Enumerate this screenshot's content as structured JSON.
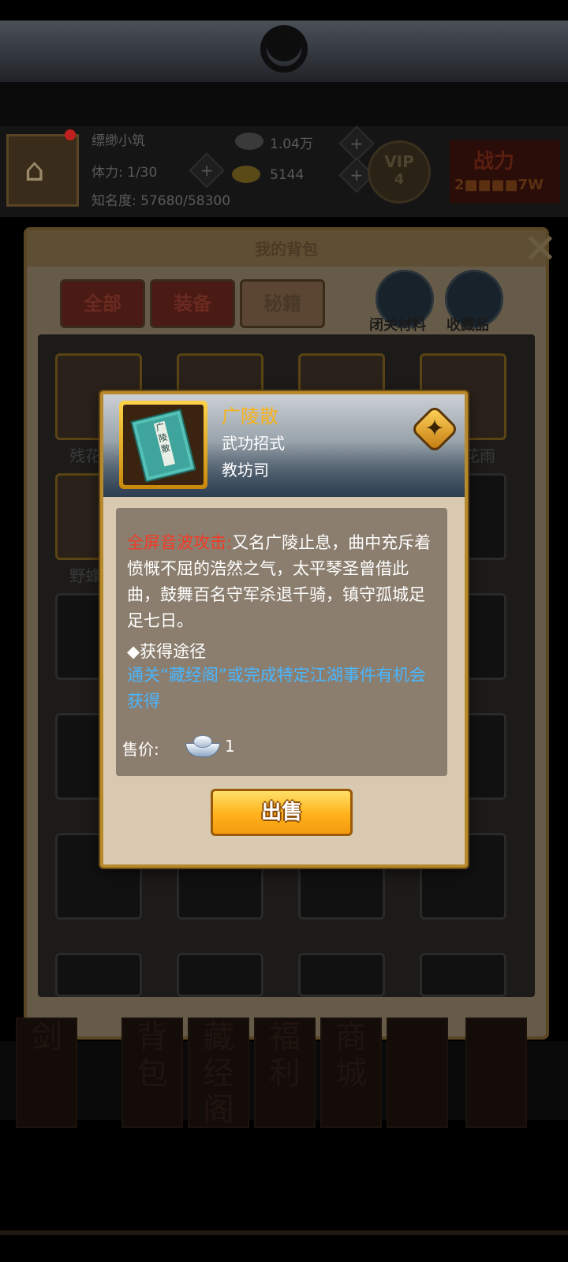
{
  "player": {
    "name": "缥缈小筑",
    "stamina": "体力: 1/30",
    "fame": "知名度: 57680/58300",
    "silver": "1.04万",
    "gold": "5144",
    "vip_label": "VIP",
    "vip_level": "4",
    "power_label": "战力",
    "power_value": "2■■■■7W"
  },
  "bag": {
    "title": "我的背包",
    "tabs": [
      {
        "label": "全部"
      },
      {
        "label": "装备"
      },
      {
        "label": "秘籍",
        "active": true
      }
    ],
    "side_buttons": [
      {
        "label": "闭关材料",
        "icon": "cauldron-icon"
      },
      {
        "label": "收藏品",
        "icon": "jade-icon"
      }
    ],
    "visible_item_names": [
      "残花",
      "花雨",
      "野蜂"
    ]
  },
  "nav": {
    "items": [
      "剑",
      "背包",
      "藏经阁",
      "福利",
      "商城",
      "",
      ""
    ]
  },
  "tooltip": {
    "item_name": "广陵散",
    "item_type": "武功招式",
    "item_origin": "教坊司",
    "book_label": "广陵散",
    "desc_label": "全屏音波攻击:",
    "desc_text": "又名广陵止息，曲中充斥着愤慨不屈的浩然之气，太平琴圣曾借此曲，鼓舞百名守军杀退千骑，镇守孤城足足七日。",
    "source_title": "◆获得途径",
    "source_text": "通关“藏经阁”或完成特定江湖事件有机会获得",
    "price_label": "售价:",
    "price_value": "1",
    "sell_label": "出售"
  },
  "colors": {
    "item_name": "#f7b21a",
    "desc_label": "#f03c28",
    "source_text": "#4ab6ff",
    "sell_button": "#ffb21a",
    "dialog_border": "#b88a2c"
  }
}
